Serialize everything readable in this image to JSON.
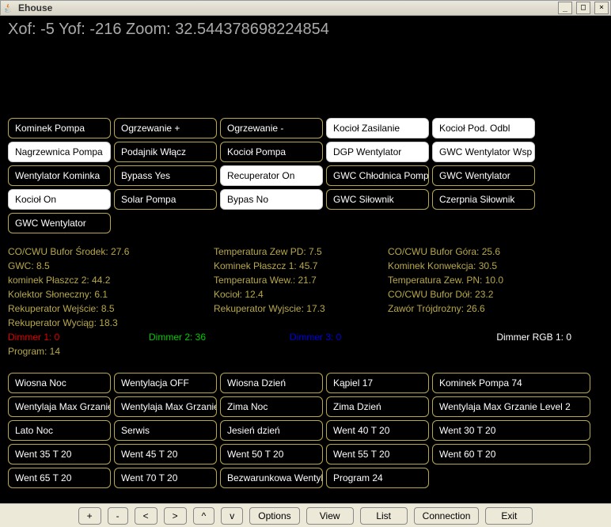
{
  "window": {
    "title": "Ehouse",
    "min": "_",
    "max": "□",
    "close": "×"
  },
  "coords": "Xof: -5 Yof: -216 Zoom: 32.544378698224854",
  "grid1": [
    {
      "label": "Kominek Pompa",
      "active": false
    },
    {
      "label": "Ogrzewanie +",
      "active": false
    },
    {
      "label": "Ogrzewanie -",
      "active": false
    },
    {
      "label": "Kocioł Zasilanie",
      "active": true
    },
    {
      "label": "Kocioł Pod. Odbl",
      "active": true
    },
    {
      "label": "Nagrzewnica Pompa",
      "active": true
    },
    {
      "label": "Podajnik Włącz",
      "active": false
    },
    {
      "label": "Kocioł Pompa",
      "active": false
    },
    {
      "label": "DGP Wentylator",
      "active": true
    },
    {
      "label": "GWC Wentylator Wsp",
      "active": true
    },
    {
      "label": "Wentylator Kominka",
      "active": false
    },
    {
      "label": "Bypass Yes",
      "active": false
    },
    {
      "label": "Recuperator On",
      "active": true
    },
    {
      "label": "GWC Chłodnica Pompa",
      "active": false
    },
    {
      "label": "GWC Wentylator",
      "active": false
    },
    {
      "label": "Kocioł On",
      "active": true
    },
    {
      "label": "Solar Pompa",
      "active": false
    },
    {
      "label": "Bypas No",
      "active": true
    },
    {
      "label": "GWC Siłownik",
      "active": false
    },
    {
      "label": "Czerpnia Siłownik",
      "active": false
    },
    {
      "label": "GWC Wentylator",
      "active": false
    }
  ],
  "sensors": {
    "col1": [
      "CO/CWU Bufor Środek: 27.6",
      "GWC: 8.5",
      "kominek Płaszcz 2: 44.2",
      "Kolektor Słoneczny: 6.1",
      "Rekuperator Wejście: 8.5",
      "Rekuperator Wyciąg: 18.3"
    ],
    "col2": [
      "Temperatura Zew PD: 7.5",
      "Kominek Płaszcz 1: 45.7",
      "Temperatura Wew.: 21.7",
      "Kocioł: 12.4",
      "Rekuperator Wyjscie: 17.3"
    ],
    "col3": [
      "CO/CWU Bufor Góra: 25.6",
      "Kominek Konwekcja: 30.5",
      "Temperatura Zew. PN: 10.0",
      "CO/CWU Bufor Dół: 23.2",
      "Zawór Trójdrożny: 26.6"
    ]
  },
  "dimmers": {
    "d1": "Dimmer 1: 0",
    "d2": "Dimmer 2: 36",
    "d3": "Dimmer 3: 0",
    "d4": "Dimmer RGB 1: 0"
  },
  "program": "Program: 14",
  "grid2": [
    "Wiosna Noc",
    "Wentylacja OFF",
    "Wiosna Dzień",
    "Kąpiel 17",
    "Kominek Pompa 74",
    "Wentylaja Max Grzanie",
    "Wentylaja Max Grzanie L",
    "Zima Noc",
    "Zima Dzień",
    "Wentylaja Max Grzanie Level 2",
    "Lato Noc",
    "Serwis",
    "Jesień dzień",
    "Went 40 T 20",
    "Went 30 T 20",
    "Went 35 T 20",
    "Went 45 T 20",
    "Went 50 T 20",
    "Went 55 T 20",
    "Went 60 T 20",
    "Went 65 T 20",
    "Went 70 T 20",
    "Bezwarunkowa Wentyla",
    "Program 24"
  ],
  "bottom": {
    "b1": "+",
    "b2": "-",
    "b3": "<",
    "b4": ">",
    "b5": "^",
    "b6": "v",
    "options": "Options",
    "view": "View",
    "list": "List",
    "connection": "Connection",
    "exit": "Exit"
  }
}
